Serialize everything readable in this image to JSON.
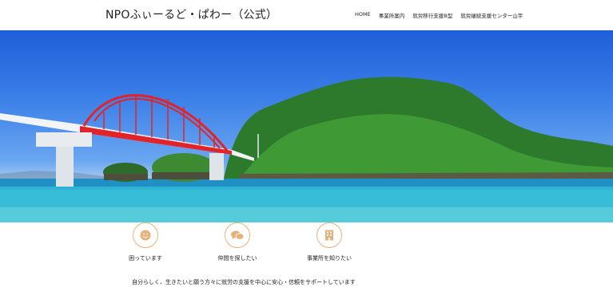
{
  "header": {
    "site_title": "NPOふぃーるど・ぱわー（公式）",
    "nav": [
      "HOME",
      "事業所案内",
      "就労移行支援B型",
      "就労継続支援センター山宇"
    ]
  },
  "features": [
    {
      "label": "困っています",
      "icon": "smile-icon"
    },
    {
      "label": "仲間を探したい",
      "icon": "chat-icon"
    },
    {
      "label": "事業所を知りたい",
      "icon": "building-icon"
    }
  ],
  "intro_text": "自分らしく、生きたいと願う方々に就労の支援を中心に安心・信頼をサポートしています",
  "colors": {
    "accent": "#e7b27a",
    "bridge": "#e0242a",
    "sea": "#2fb3d4",
    "sky": "#2d6ee0"
  }
}
